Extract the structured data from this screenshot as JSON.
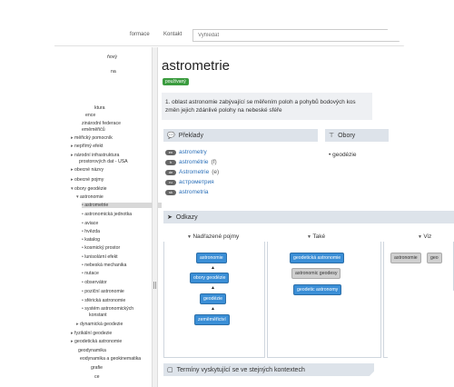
{
  "nav": {
    "link1": "formace",
    "link2": "Kontakt",
    "search_placeholder": "Vyhledat"
  },
  "sidebar": {
    "items": [
      "ňový",
      "na",
      "ktura",
      "ence",
      "zinárodní federace",
      "eměměřičů",
      "měřický pomocník",
      "nepřímý efekt",
      "národní infrastruktura",
      "prostorových dat - USA",
      "obecné názvy",
      "obecné pojmy",
      "obory geodézie",
      "astronomie",
      "astrometrie",
      "astronomická jednotka",
      "aviace",
      "hvězda",
      "katalog",
      "kosmický prostor",
      "lunisolární efekt",
      "nebeská mechanika",
      "nutace",
      "observátor",
      "poziční astronomie",
      "sférická astronomie",
      "systém astronomických",
      "konstant",
      "dynamická geodezie",
      "fyzikální geodezie",
      "geodetická astronomie",
      "geodynamika",
      "eodynamika a geokinematika",
      "grafie",
      "ce"
    ]
  },
  "main": {
    "title": "astrometrie",
    "status": "používaný",
    "definition_line1": "1. oblast astronomie zabývající se měřením poloh a pohybů bodových kos",
    "definition_line2": "změn jejich zdánlivé polohy na nebeské sféře",
    "translations_title": "Překlady",
    "translations": [
      {
        "lang": "en",
        "word": "astrometry",
        "gram": ""
      },
      {
        "lang": "fr",
        "word": "astrométrie",
        "gram": "(f)"
      },
      {
        "lang": "de",
        "word": "Astrometrie",
        "gram": "(e)"
      },
      {
        "lang": "ru",
        "word": "астрометрия",
        "gram": ""
      },
      {
        "lang": "sk",
        "word": "astrometria",
        "gram": ""
      }
    ],
    "obory_title": "Obory",
    "obory": [
      "geodézie"
    ],
    "odkazy_title": "Odkazy",
    "col_nadrazene": "Nadřazené pojmy",
    "col_take": "Také",
    "col_viz": "Viz",
    "nadrazene_nodes": [
      "astronomie",
      "obory geodézie",
      "geodézie",
      "zeměměřictví"
    ],
    "take_nodes": [
      "geodetická astronomie",
      "astronomic geodesy",
      "geodetic astronomy"
    ],
    "viz_nodes": [
      "astronomie",
      "geo"
    ],
    "terminy_title": "Termíny vyskytující se ve stejných kontextech"
  },
  "colors": {
    "accent": "#3a8ed6",
    "status": "#3b9c3f",
    "panel": "#dde3ea"
  }
}
